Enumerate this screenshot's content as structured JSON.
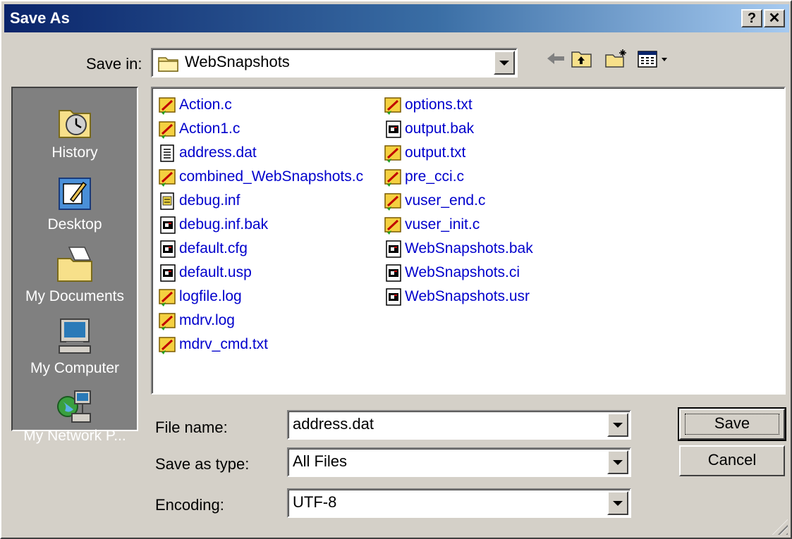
{
  "window": {
    "title": "Save As",
    "help_btn": "?",
    "close_btn": "✕"
  },
  "save_in": {
    "label": "Save in:",
    "value": "WebSnapshots"
  },
  "places": [
    {
      "label": "History",
      "icon": "history-icon"
    },
    {
      "label": "Desktop",
      "icon": "desktop-icon"
    },
    {
      "label": "My Documents",
      "icon": "my-documents-icon"
    },
    {
      "label": "My Computer",
      "icon": "my-computer-icon"
    },
    {
      "label": "My Network P...",
      "icon": "network-places-icon"
    }
  ],
  "files": {
    "column1": [
      {
        "name": "Action.c",
        "icon": "script-icon"
      },
      {
        "name": "Action1.c",
        "icon": "script-icon"
      },
      {
        "name": "address.dat",
        "icon": "text-file-icon"
      },
      {
        "name": "combined_WebSnapshots.c",
        "icon": "script-icon"
      },
      {
        "name": "debug.inf",
        "icon": "inf-file-icon"
      },
      {
        "name": "debug.inf.bak",
        "icon": "app-file-icon"
      },
      {
        "name": "default.cfg",
        "icon": "app-file-icon"
      },
      {
        "name": "default.usp",
        "icon": "app-file-icon"
      },
      {
        "name": "logfile.log",
        "icon": "script-icon"
      },
      {
        "name": "mdrv.log",
        "icon": "script-icon"
      },
      {
        "name": "mdrv_cmd.txt",
        "icon": "script-icon"
      }
    ],
    "column2": [
      {
        "name": "options.txt",
        "icon": "script-icon"
      },
      {
        "name": "output.bak",
        "icon": "app-file-icon"
      },
      {
        "name": "output.txt",
        "icon": "script-icon"
      },
      {
        "name": "pre_cci.c",
        "icon": "script-icon"
      },
      {
        "name": "vuser_end.c",
        "icon": "script-icon"
      },
      {
        "name": "vuser_init.c",
        "icon": "script-icon"
      },
      {
        "name": "WebSnapshots.bak",
        "icon": "app-file-icon"
      },
      {
        "name": "WebSnapshots.ci",
        "icon": "app-file-icon"
      },
      {
        "name": "WebSnapshots.usr",
        "icon": "app-file-icon"
      }
    ]
  },
  "form": {
    "file_name_label": "File name:",
    "file_name_value": "address.dat",
    "save_type_label": "Save as type:",
    "save_type_value": "All Files",
    "encoding_label": "Encoding:",
    "encoding_value": "UTF-8"
  },
  "buttons": {
    "save": "Save",
    "cancel": "Cancel"
  },
  "colors": {
    "title_gradient_start": "#0a246a",
    "title_gradient_end": "#a6caf0",
    "dialog_face": "#d4d0c8",
    "places_bar": "#808080",
    "file_link_text": "#0000cc"
  }
}
